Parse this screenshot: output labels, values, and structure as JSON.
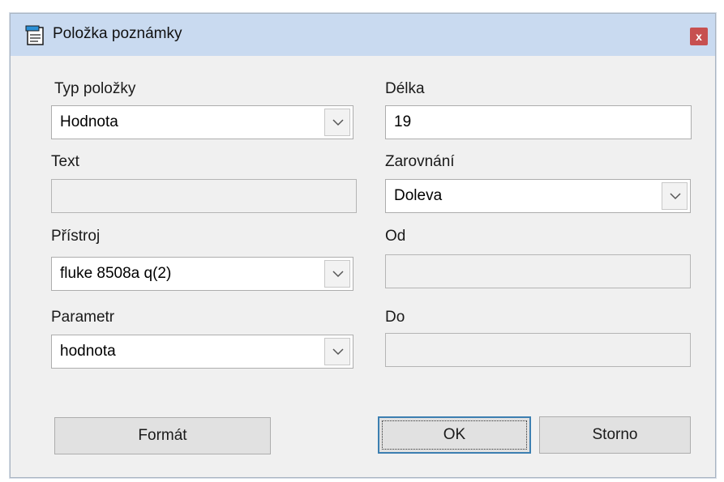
{
  "window": {
    "title": "Položka poznámky",
    "close_label": "x"
  },
  "form": {
    "typ_polozky": {
      "label": "Typ položky",
      "value": "Hodnota"
    },
    "text": {
      "label": "Text",
      "value": ""
    },
    "pristroj": {
      "label": "Přístroj",
      "value": "fluke 8508a q(2)"
    },
    "parametr": {
      "label": "Parametr",
      "value": "hodnota"
    },
    "delka": {
      "label": "Délka",
      "value": "19"
    },
    "zarovnani": {
      "label": "Zarovnání",
      "value": "Doleva"
    },
    "od": {
      "label": "Od",
      "value": ""
    },
    "do": {
      "label": "Do",
      "value": ""
    }
  },
  "buttons": {
    "format": "Formát",
    "ok": "OK",
    "storno": "Storno"
  }
}
